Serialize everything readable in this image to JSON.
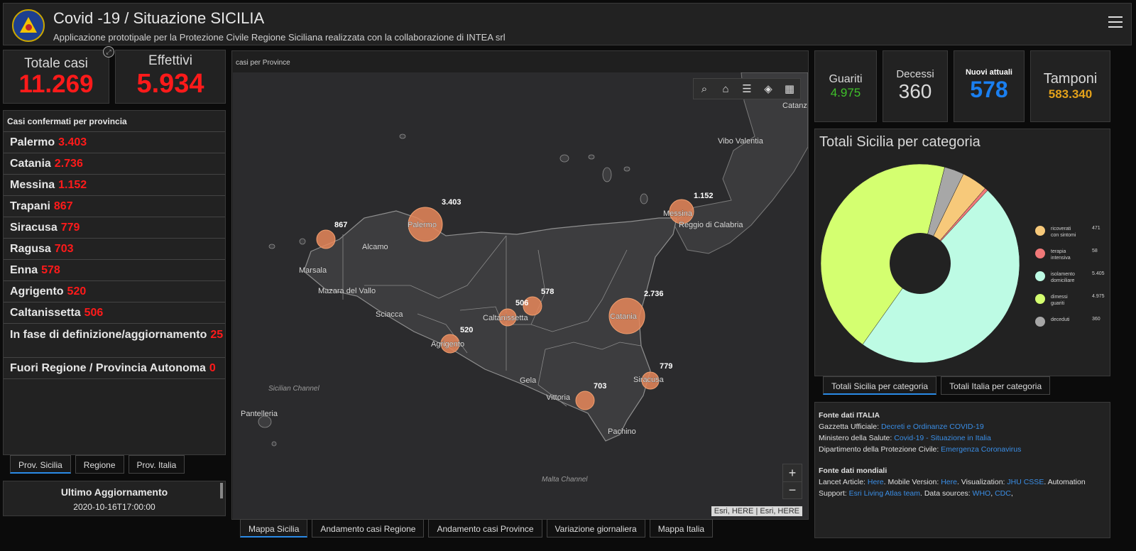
{
  "header": {
    "title": "Covid -19 / Situazione SICILIA",
    "subtitle": "Applicazione prototipale per la Protezione Civile Regione Siciliana realizzata con la collaborazione di INTEA srl"
  },
  "kpis": {
    "totale": {
      "label": "Totale casi",
      "value": "11.269"
    },
    "effettivi": {
      "label": "Effettivi",
      "value": "5.934"
    },
    "guariti": {
      "label": "Guariti",
      "value": "4.975"
    },
    "decessi": {
      "label": "Decessi",
      "value": "360"
    },
    "nuovi": {
      "label": "Nuovi attuali",
      "value": "578"
    },
    "tamponi": {
      "label": "Tamponi",
      "value": "583.340"
    }
  },
  "provinces": {
    "title": "Casi confermati per provincia",
    "items": [
      {
        "name": "Palermo",
        "value": "3.403"
      },
      {
        "name": "Catania",
        "value": "2.736"
      },
      {
        "name": "Messina",
        "value": "1.152"
      },
      {
        "name": "Trapani",
        "value": "867"
      },
      {
        "name": "Siracusa",
        "value": "779"
      },
      {
        "name": "Ragusa",
        "value": "703"
      },
      {
        "name": "Enna",
        "value": "578"
      },
      {
        "name": "Agrigento",
        "value": "520"
      },
      {
        "name": "Caltanissetta",
        "value": "506"
      },
      {
        "name": "In fase di definizione/aggiornamento",
        "value": "25"
      },
      {
        "name": "Fuori Regione / Provincia Autonoma",
        "value": "0"
      }
    ],
    "tabs": [
      "Prov. Sicilia",
      "Regione",
      "Prov. Italia"
    ]
  },
  "update": {
    "title": "Ultimo Aggiornamento",
    "value": "2020-10-16T17:00:00"
  },
  "map": {
    "title": "casi per Province",
    "labels": {
      "catanz": "Catanz",
      "vibo": "Vibo Valentia",
      "reggio": "Reggio di Calabria",
      "alcamo": "Alcamo",
      "marsala": "Marsala",
      "mazara": "Mazara del Vallo",
      "sciacca": "Sciacca",
      "gela": "Gela",
      "vittoria": "Vittoria",
      "pachino": "Pachino",
      "channel1": "Sicilian Channel",
      "pantelleria": "Pantelleria",
      "malta": "Malta Channel",
      "palermo": "Palermo",
      "messina": "Messina",
      "catania": "Catania",
      "caltanissetta": "Caltanissetta",
      "agrigento": "Agrigento",
      "siracusa": "Siracusa"
    },
    "bubbles": {
      "palermo": "3.403",
      "messina": "1.152",
      "trapani": "867",
      "catania": "2.736",
      "enna": "578",
      "caltanissetta": "506",
      "agrigento": "520",
      "siracusa": "779",
      "ragusa": "703"
    },
    "attribution": "Esri, HERE | Esri, HERE",
    "tabs": [
      "Mappa Sicilia",
      "Andamento casi Regione",
      "Andamento casi Province",
      "Variazione giornaliera",
      "Mappa Italia"
    ]
  },
  "chart_data": {
    "type": "pie",
    "title": "Totali Sicilia per categoria",
    "slices": [
      {
        "label": "ricoverati con sintomi",
        "value": 471,
        "color": "#f7c97a"
      },
      {
        "label": "terapia intensiva",
        "value": 58,
        "color": "#f07878"
      },
      {
        "label": "isolamento domiciliare",
        "value": 5405,
        "color": "#bdfbe4"
      },
      {
        "label": "dimessi guariti",
        "value": 4975,
        "color": "#d4ff70"
      },
      {
        "label": "deceduti",
        "value": 360,
        "color": "#a7a7a7"
      }
    ]
  },
  "chart_legend": [
    {
      "l1": "ricoverati",
      "l2": "con sintomi",
      "v": "471"
    },
    {
      "l1": "terapia",
      "l2": "intensiva",
      "v": "58"
    },
    {
      "l1": "isolamento",
      "l2": "domiciliare",
      "v": "5.405"
    },
    {
      "l1": "dimessi",
      "l2": "guariti",
      "v": "4.975"
    },
    {
      "l1": "deceduti",
      "l2": "",
      "v": "360"
    }
  ],
  "chart_tabs": [
    "Totali Sicilia per categoria",
    "Totali Italia per categoria"
  ],
  "sources": {
    "it_title": "Fonte dati ITALIA",
    "gazzetta_label": "Gazzetta Ufficiale: ",
    "gazzetta_link": "Decreti e Ordinanze COVID-19",
    "ministero_label": "Ministero della Salute: ",
    "ministero_link": "Covid-19 - Situazione in Italia",
    "protciv_label": "Dipartimento della Protezione Civile: ",
    "protciv_link": "Emergenza Coronavirus",
    "world_title": "Fonte dati mondiali",
    "lancet_label": "Lancet Article: ",
    "lancet_link": "Here",
    "mobile_label": ". Mobile Version: ",
    "mobile_link": "Here",
    "vis_label": ". Visualization: ",
    "vis_link": "JHU CSSE",
    "auto_label": ". Automation Support: ",
    "esri_link": "Esri Living Atlas team",
    "data_label": ". Data sources: ",
    "who_link": "WHO",
    "cdc_link": "CDC"
  }
}
